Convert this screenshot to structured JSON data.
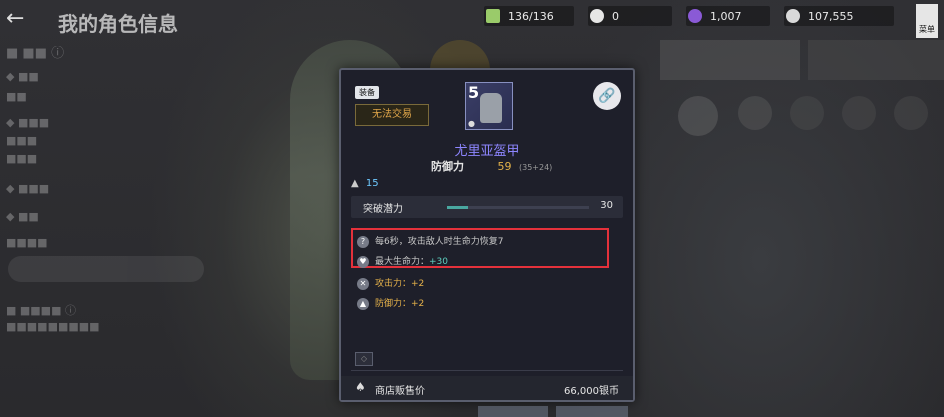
{
  "header": {
    "title": "我的角色信息",
    "back_icon": "arrow-left-icon",
    "currencies": [
      {
        "icon": "energy-icon",
        "color": "#9acb6a",
        "value": "136/136"
      },
      {
        "icon": "pearl-icon",
        "color": "#e6e6e6",
        "value": "0"
      },
      {
        "icon": "purple-gem-icon",
        "color": "#8a5ad6",
        "value": "1,007"
      },
      {
        "icon": "silver-coin-icon",
        "color": "#d9d9d9",
        "value": "107,555"
      }
    ],
    "corner_label": "菜单"
  },
  "item_card": {
    "equip_badge": "装备",
    "trade_status": "无法交易",
    "item_level": "5",
    "item_name": "尤里亚盔甲",
    "defense_label": "防御力",
    "defense_value": "59",
    "defense_breakdown": "(35+24)",
    "upgrade_count": "15",
    "potential_label": "突破潜力",
    "potential_value": "30",
    "potential_fraction": 0.15,
    "effect_1": "每6秒，攻击敌人时生命力恢复7",
    "effect_2_label": "最大生命力：",
    "effect_2_value": "+30",
    "bonus_1": "攻击力：+2",
    "bonus_2": "防御力：+2",
    "sell_label": "商店贩售价",
    "sell_price": "66,000银币"
  },
  "colors": {
    "item_name": "#8e86ff",
    "highlight_border": "#e4313b",
    "stat_gold": "#e3b24a"
  }
}
